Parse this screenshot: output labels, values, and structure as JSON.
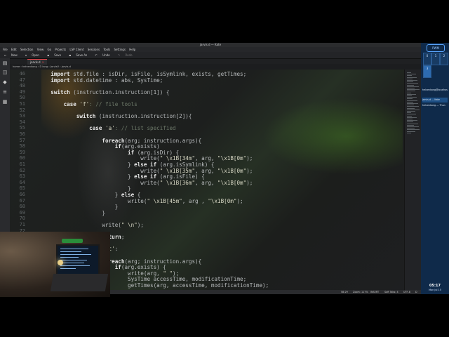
{
  "window": {
    "title": "jarvis.d — Kate"
  },
  "menu": [
    "File",
    "Edit",
    "Selection",
    "View",
    "Go",
    "Projects",
    "LSP Client",
    "Sessions",
    "Tools",
    "Settings",
    "Help"
  ],
  "toolbar": {
    "new": "New",
    "open": "Open",
    "save": "Save",
    "save_as": "Save As",
    "undo": "Undo",
    "redo": "Redo"
  },
  "tab": {
    "label": "jarvis.d",
    "close": "×"
  },
  "breadcrumb": "home  ›  helvenkong  ›  D lang  ›  JarvisV  ›  jarvis.d",
  "line_numbers": [
    "46",
    "47",
    "48",
    "49",
    "50",
    "51",
    "52",
    "53",
    "54",
    "55",
    "56",
    "57",
    "58",
    "59",
    "60",
    "61",
    "62",
    "63",
    "64",
    "65",
    "66",
    "67",
    "68",
    "69",
    "70",
    "71",
    "72",
    "73",
    "74",
    "75",
    "76",
    "77",
    "78",
    "79"
  ],
  "code_lines": [
    [
      {
        "k": "kw",
        "t": "    import"
      },
      {
        "k": "",
        "t": " std.file : isDir, isFile, isSymlink, exists, getTimes;"
      }
    ],
    [
      {
        "k": "kw",
        "t": "    import"
      },
      {
        "k": "",
        "t": " std.datetime : abs, SysTime;"
      }
    ],
    [
      {
        "k": "",
        "t": ""
      }
    ],
    [
      {
        "k": "kw",
        "t": "    switch"
      },
      {
        "k": "",
        "t": " (instruction.instruction[1]) {"
      }
    ],
    [
      {
        "k": "",
        "t": ""
      }
    ],
    [
      {
        "k": "kw",
        "t": "        case"
      },
      {
        "k": "st",
        "t": " 'f'"
      },
      {
        "k": "cm",
        "t": ": // file tools"
      }
    ],
    [
      {
        "k": "",
        "t": ""
      }
    ],
    [
      {
        "k": "kw",
        "t": "            switch"
      },
      {
        "k": "",
        "t": " (instruction.instruction[2]){"
      }
    ],
    [
      {
        "k": "",
        "t": ""
      }
    ],
    [
      {
        "k": "kw",
        "t": "                case"
      },
      {
        "k": "st",
        "t": " 'a'"
      },
      {
        "k": "cm",
        "t": ": // list specified"
      }
    ],
    [
      {
        "k": "",
        "t": ""
      }
    ],
    [
      {
        "k": "kw",
        "t": "                    foreach"
      },
      {
        "k": "",
        "t": "(arg; instruction.args){"
      }
    ],
    [
      {
        "k": "kw",
        "t": "                        if"
      },
      {
        "k": "",
        "t": "(arg.exists)"
      }
    ],
    [
      {
        "k": "kw",
        "t": "                            if"
      },
      {
        "k": "",
        "t": " (arg.isDir) {"
      }
    ],
    [
      {
        "k": "",
        "t": "                                write("
      },
      {
        "k": "st",
        "t": "\" \\x1B[34m\""
      },
      {
        "k": "",
        "t": ", arg, "
      },
      {
        "k": "st",
        "t": "\"\\x1B[0m\""
      },
      {
        "k": "",
        "t": ");"
      }
    ],
    [
      {
        "k": "",
        "t": "                            } "
      },
      {
        "k": "kw",
        "t": "else if"
      },
      {
        "k": "",
        "t": " (arg.isSymlink) {"
      }
    ],
    [
      {
        "k": "",
        "t": "                                write("
      },
      {
        "k": "st",
        "t": "\" \\x1B[35m\""
      },
      {
        "k": "",
        "t": ", arg, "
      },
      {
        "k": "st",
        "t": "\"\\x1B[0m\""
      },
      {
        "k": "",
        "t": ");"
      }
    ],
    [
      {
        "k": "",
        "t": "                            } "
      },
      {
        "k": "kw",
        "t": "else if"
      },
      {
        "k": "",
        "t": " (arg.isFile) {"
      }
    ],
    [
      {
        "k": "",
        "t": "                                write("
      },
      {
        "k": "st",
        "t": "\" \\x1B[36m\""
      },
      {
        "k": "",
        "t": ", arg, "
      },
      {
        "k": "st",
        "t": "\"\\x1B[0m\""
      },
      {
        "k": "",
        "t": ");"
      }
    ],
    [
      {
        "k": "",
        "t": "                            }"
      }
    ],
    [
      {
        "k": "",
        "t": "                        } "
      },
      {
        "k": "kw",
        "t": "else"
      },
      {
        "k": "",
        "t": " {"
      }
    ],
    [
      {
        "k": "",
        "t": "                            write("
      },
      {
        "k": "st",
        "t": "\" \\x1B[45m\""
      },
      {
        "k": "",
        "t": ", arg , "
      },
      {
        "k": "st",
        "t": "\"\\x1B[0m\""
      },
      {
        "k": "",
        "t": ");"
      }
    ],
    [
      {
        "k": "",
        "t": "                        }"
      }
    ],
    [
      {
        "k": "",
        "t": "                    }"
      }
    ],
    [
      {
        "k": "",
        "t": ""
      }
    ],
    [
      {
        "k": "",
        "t": "                    write("
      },
      {
        "k": "st",
        "t": "\" \\n\""
      },
      {
        "k": "",
        "t": ");"
      }
    ],
    [
      {
        "k": "",
        "t": ""
      }
    ],
    [
      {
        "k": "kw",
        "t": "                    return"
      },
      {
        "k": "",
        "t": ";"
      }
    ],
    [
      {
        "k": "",
        "t": ""
      }
    ],
    [
      {
        "k": "kw",
        "t": "                case"
      },
      {
        "k": "st",
        "t": " 't'"
      },
      {
        "k": "",
        "t": ":"
      }
    ],
    [
      {
        "k": "",
        "t": ""
      }
    ],
    [
      {
        "k": "kw",
        "t": "                    foreach"
      },
      {
        "k": "",
        "t": "(arg; instruction.args){"
      }
    ],
    [
      {
        "k": "kw",
        "t": "                        if"
      },
      {
        "k": "",
        "t": "(arg.exists) {"
      }
    ],
    [
      {
        "k": "",
        "t": "                            write(arg, "
      },
      {
        "k": "st",
        "t": "\" \""
      },
      {
        "k": "",
        "t": ");"
      }
    ],
    [
      {
        "k": "",
        "t": "                            SysTime accessTime, modificationTime;"
      }
    ],
    [
      {
        "k": "",
        "t": "                            getTimes(arg, accessTime, modificationTime);"
      }
    ]
  ],
  "status": {
    "position": "58:29",
    "zoom": "Zoom: 117%",
    "mode": "INSERT",
    "tabs": "Soft Tabs: 4",
    "encoding": "UTF-8",
    "lang": "D"
  },
  "panel": {
    "logo": "PWM",
    "desktops": [
      "0",
      "1",
      "2",
      "3"
    ],
    "tasks": [
      "helvenkong@localhost",
      "jarvis.d — Kate",
      "helvenkong — Thun"
    ],
    "clock": "05:17",
    "date": "Mon Jul 15"
  }
}
